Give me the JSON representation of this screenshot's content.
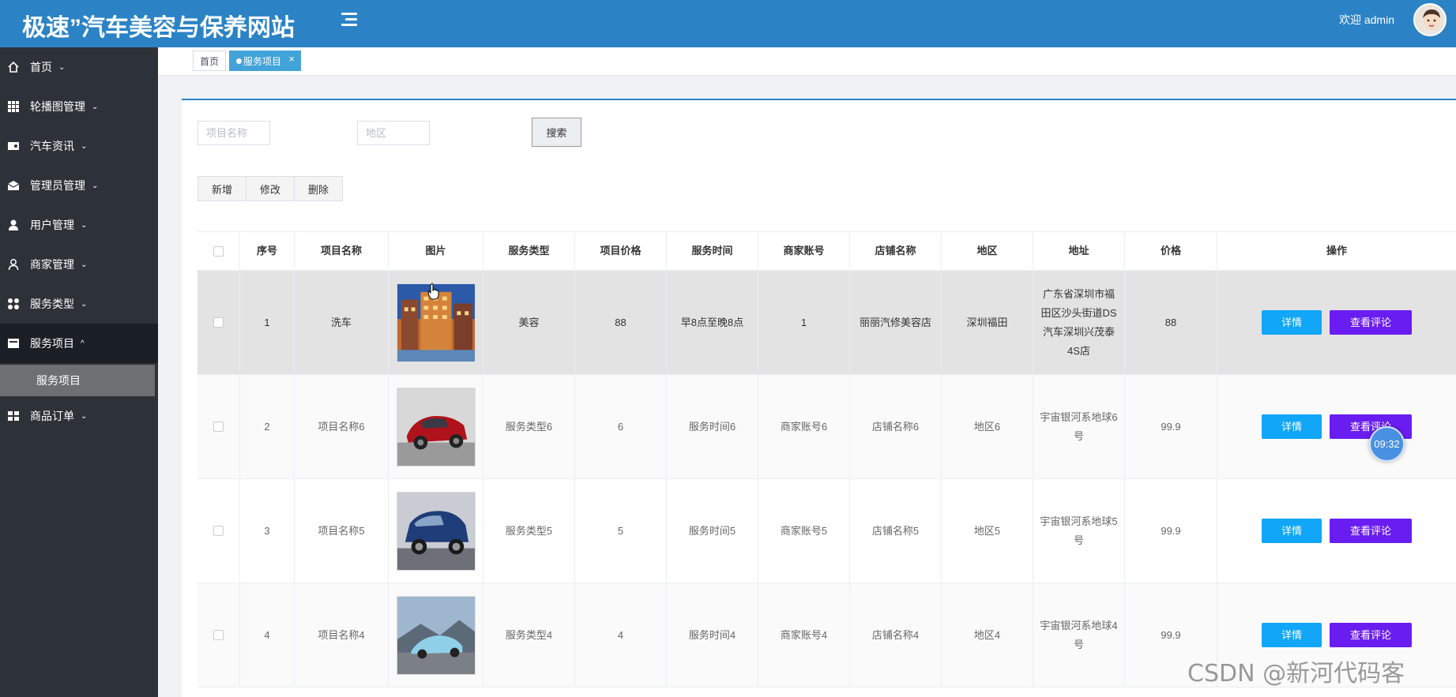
{
  "header": {
    "app_title": "极速”汽车美容与保养网站",
    "welcome": "欢迎 admin"
  },
  "sidebar": {
    "items": [
      {
        "label": "首页",
        "icon": "home-icon"
      },
      {
        "label": "轮播图管理",
        "icon": "grid-icon"
      },
      {
        "label": "汽车资讯",
        "icon": "wallet-icon"
      },
      {
        "label": "管理员管理",
        "icon": "envelope-icon"
      },
      {
        "label": "用户管理",
        "icon": "user-icon"
      },
      {
        "label": "商家管理",
        "icon": "user-outline-icon"
      },
      {
        "label": "服务类型",
        "icon": "apps-icon"
      },
      {
        "label": "服务项目",
        "icon": "list-icon"
      },
      {
        "label": "商品订单",
        "icon": "table-icon"
      }
    ],
    "sub_item": "服务项目"
  },
  "tabs": {
    "home": "首页",
    "current": "服务项目"
  },
  "search": {
    "name_placeholder": "项目名称",
    "region_placeholder": "地区",
    "button": "搜索"
  },
  "toolbar": {
    "add": "新增",
    "edit": "修改",
    "delete": "删除"
  },
  "table": {
    "headers": [
      "序号",
      "项目名称",
      "图片",
      "服务类型",
      "项目价格",
      "服务时间",
      "商家账号",
      "店铺名称",
      "地区",
      "地址",
      "价格",
      "操作"
    ],
    "rows": [
      {
        "no": "1",
        "name": "洗车",
        "type": "美容",
        "item_price": "88",
        "time": "早8点至晚8点",
        "account": "1",
        "shop": "丽丽汽修美容店",
        "region": "深圳福田",
        "address": "广东省深圳市福田区沙头街道DS汽车深圳兴茂泰4S店",
        "price": "88"
      },
      {
        "no": "2",
        "name": "项目名称6",
        "type": "服务类型6",
        "item_price": "6",
        "time": "服务时间6",
        "account": "商家账号6",
        "shop": "店铺名称6",
        "region": "地区6",
        "address": "宇宙银河系地球6号",
        "price": "99.9"
      },
      {
        "no": "3",
        "name": "项目名称5",
        "type": "服务类型5",
        "item_price": "5",
        "time": "服务时间5",
        "account": "商家账号5",
        "shop": "店铺名称5",
        "region": "地区5",
        "address": "宇宙银河系地球5号",
        "price": "99.9"
      },
      {
        "no": "4",
        "name": "项目名称4",
        "type": "服务类型4",
        "item_price": "4",
        "time": "服务时间4",
        "account": "商家账号4",
        "shop": "店铺名称4",
        "region": "地区4",
        "address": "宇宙银河系地球4号",
        "price": "99.9"
      }
    ],
    "detail_label": "详情",
    "review_label": "查看评论"
  },
  "timer": "09:32",
  "watermark": "CSDN @新河代码客",
  "colors": {
    "header": "#2b83c6",
    "sidebar": "#2d3238",
    "detail_button": "#11a6f7",
    "review_button": "#6a1df0"
  }
}
